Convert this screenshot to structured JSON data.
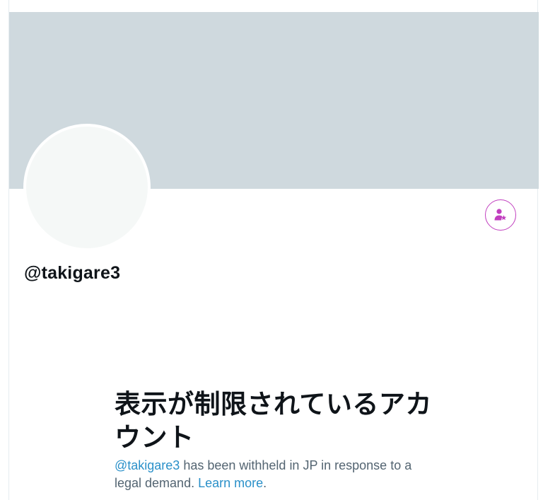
{
  "profile": {
    "handle": "@takigare3",
    "follow_button_icon": "person-star-icon"
  },
  "withheld": {
    "title": "表示が制限されているアカウント",
    "handle_link": "@takigare3",
    "message": " has been withheld in JP in response to a legal demand. ",
    "learn_more": "Learn more",
    "end_punct": "."
  },
  "colors": {
    "banner": "#cfd9de",
    "avatar": "#f5f8f7",
    "accent": "#c13fbf",
    "link": "#2a90c9"
  }
}
